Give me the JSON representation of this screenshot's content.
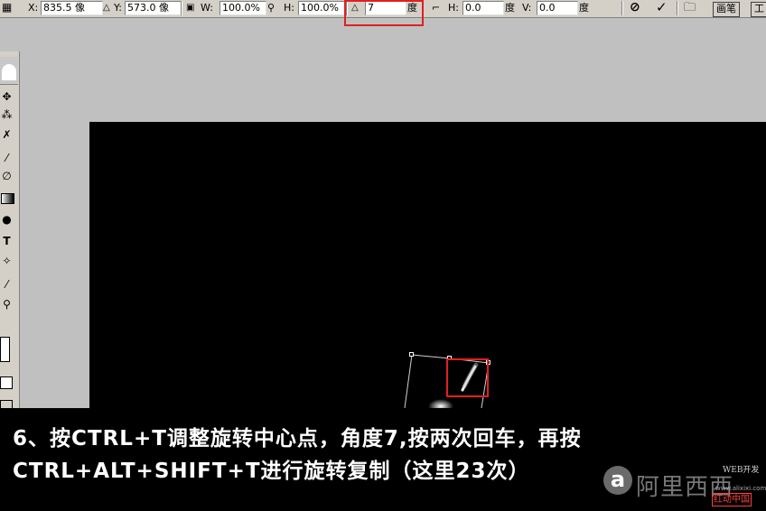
{
  "options_bar": {
    "x_label": "X:",
    "x_value": "835.5 像",
    "y_label": "Y:",
    "y_value": "573.0 像",
    "w_label": "W:",
    "w_value": "100.0%",
    "h_label": "H:",
    "h_value": "100.0%",
    "angle_value": "7",
    "degree_unit": "度",
    "skew_h_label": "H:",
    "skew_h_value": "0.0",
    "skew_v_label": "V:",
    "skew_v_value": "0.0",
    "tab_brushes": "画笔",
    "tab_tools": "工"
  },
  "caption": {
    "line1": "6、按CTRL+T调整旋转中心点，角度7,按两次回车，再按",
    "line2": "CTRL+ALT+SHIFT+T进行旋转复制（这里23次）"
  },
  "watermark": {
    "logo_letter": "a",
    "brand": "阿里西西",
    "tag": "WEB开发",
    "small": "www.alixixi.com",
    "stamp": "红动中国"
  },
  "colors": {
    "highlight": "#e02020",
    "canvas": "#000000",
    "ui_gray": "#d4d0c8",
    "workspace": "#c0c0c0"
  }
}
